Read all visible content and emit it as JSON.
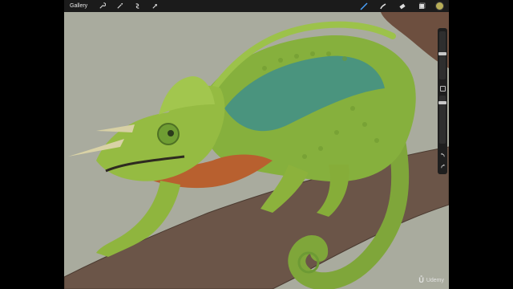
{
  "app": {
    "gallery_label": "Gallery",
    "watermark": "Udemy"
  },
  "toolbar": {
    "left_tools": [
      "wrench-icon",
      "magic-wand-icon",
      "selection-icon",
      "transform-arrow-icon"
    ],
    "right_tools": [
      "brush-icon",
      "smudge-icon",
      "eraser-icon",
      "layers-icon"
    ],
    "active_tool": "brush-icon",
    "color_swatch": "#b8ae58"
  },
  "sidebar": {
    "brush_size": 0.58,
    "opacity": 0.72
  }
}
